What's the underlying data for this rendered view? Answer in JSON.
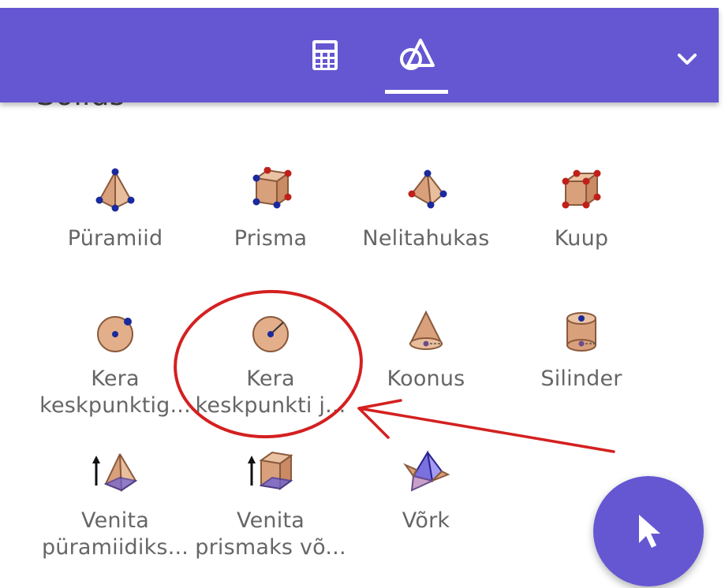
{
  "section": {
    "title": "Solids"
  },
  "toolbar": {
    "tabs": [
      {
        "name": "calculator-icon"
      },
      {
        "name": "geometry-shapes-icon",
        "active": true
      }
    ],
    "menu_icon": "chevron-down-icon"
  },
  "tools": [
    {
      "label": "Püramiid"
    },
    {
      "label": "Prisma"
    },
    {
      "label": "Nelitahukas"
    },
    {
      "label": "Kuup"
    },
    {
      "label_line1": "Kera",
      "label_line2": "keskpunktig..."
    },
    {
      "label_line1": "Kera",
      "label_line2": "keskpunkti j..."
    },
    {
      "label": "Koonus"
    },
    {
      "label": "Silinder"
    },
    {
      "label_line1": "Venita",
      "label_line2": "püramiidiks..."
    },
    {
      "label_line1": "Venita",
      "label_line2": "prismaks võ..."
    },
    {
      "label": "Võrk"
    }
  ],
  "fab": {
    "icon": "cursor-arrow-icon"
  },
  "colors": {
    "accent": "#6557D2",
    "annotation": "#D42020"
  }
}
